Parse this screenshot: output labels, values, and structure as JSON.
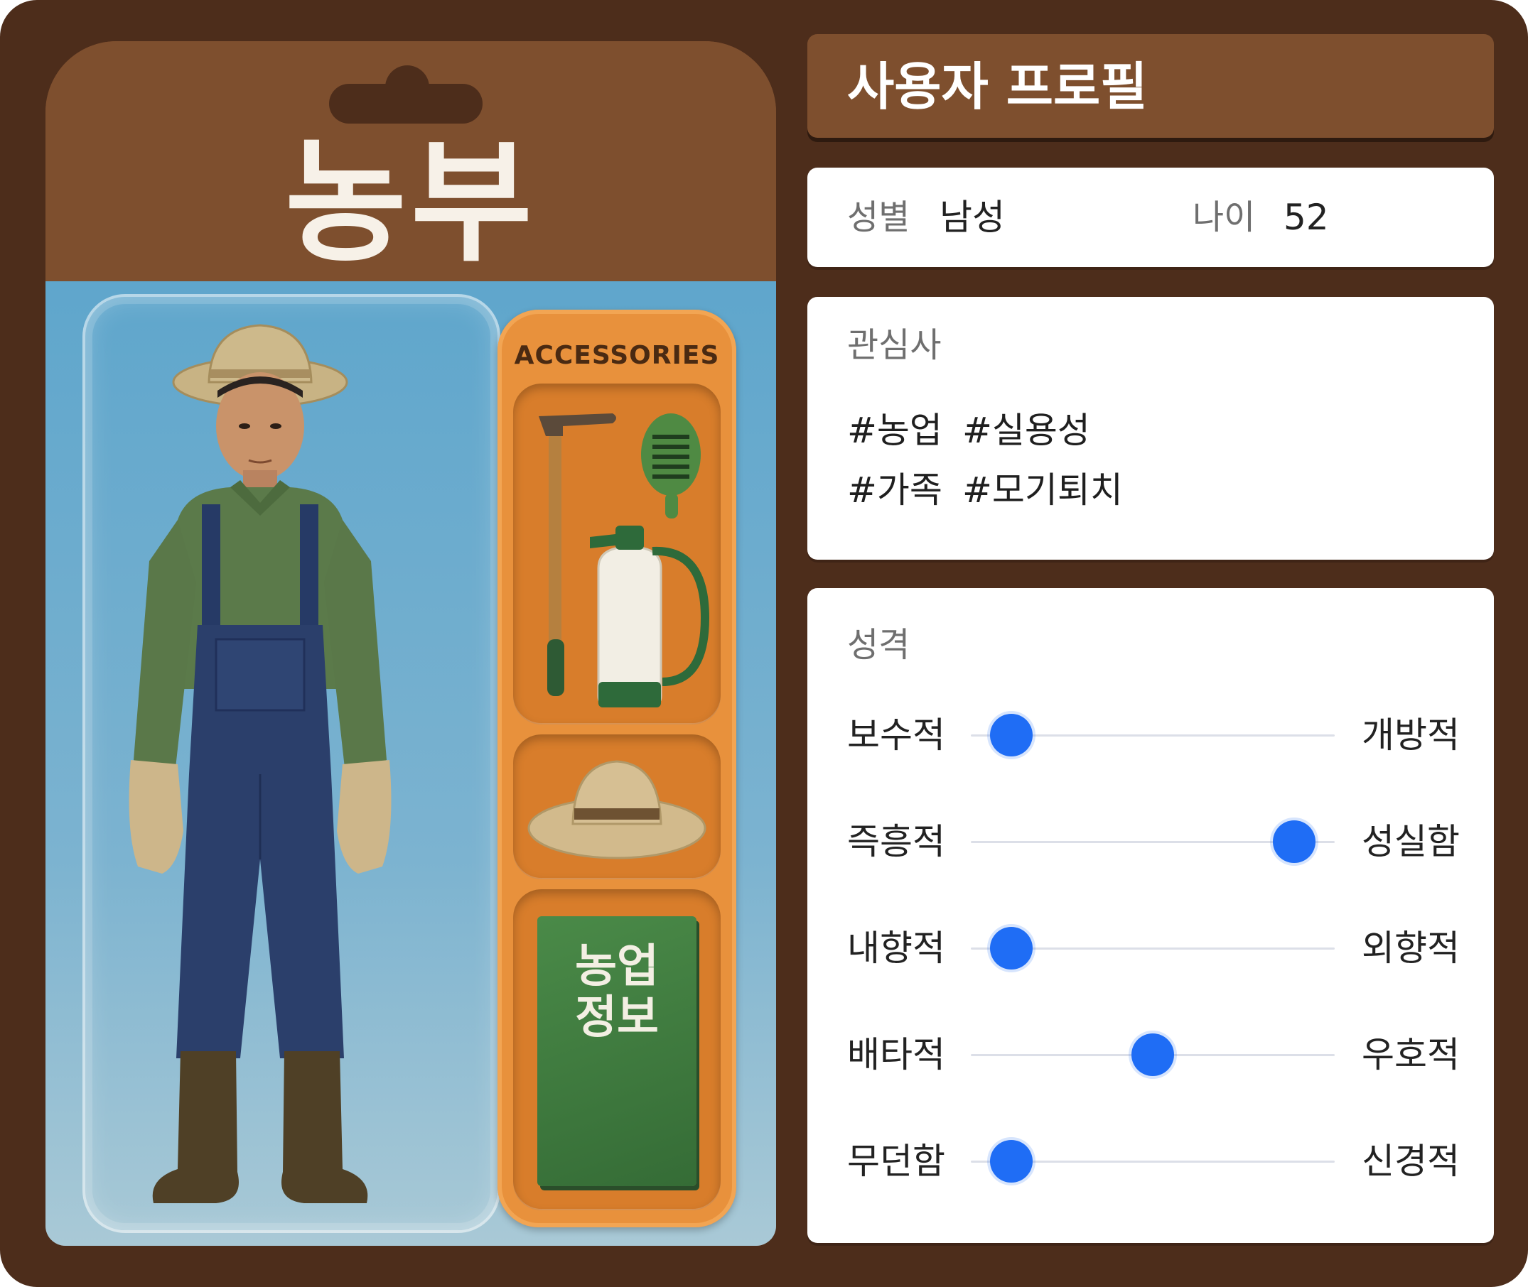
{
  "package": {
    "title": "농부",
    "tray_label": "ACCESSORIES",
    "book_title_line1": "농업",
    "book_title_line2": "정보"
  },
  "profile": {
    "header_title": "사용자 프로필",
    "basic": {
      "gender_label": "성별",
      "gender_value": "남성",
      "age_label": "나이",
      "age_value": "52"
    },
    "interests": {
      "label": "관심사",
      "tags": [
        "#농업",
        "#실용성",
        "#가족",
        "#모기퇴치"
      ]
    },
    "personality": {
      "label": "성격",
      "traits": [
        {
          "left": "보수적",
          "right": "개방적",
          "value": 0.06
        },
        {
          "left": "즉흥적",
          "right": "성실함",
          "value": 0.94
        },
        {
          "left": "내향적",
          "right": "외향적",
          "value": 0.06
        },
        {
          "left": "배타적",
          "right": "우호적",
          "value": 0.5
        },
        {
          "left": "무던함",
          "right": "신경적",
          "value": 0.06
        }
      ]
    }
  },
  "colors": {
    "frame": "#4d2d1b",
    "brand_brown": "#7e4f2e",
    "slider_accent": "#1f6df5",
    "tray_orange": "#e8913c",
    "blister_blue": "#5fa6cc"
  },
  "icons": [
    "farmer-figure",
    "hoe-icon",
    "fly-swatter-icon",
    "spray-bottle-icon",
    "hat-icon",
    "book-icon"
  ]
}
